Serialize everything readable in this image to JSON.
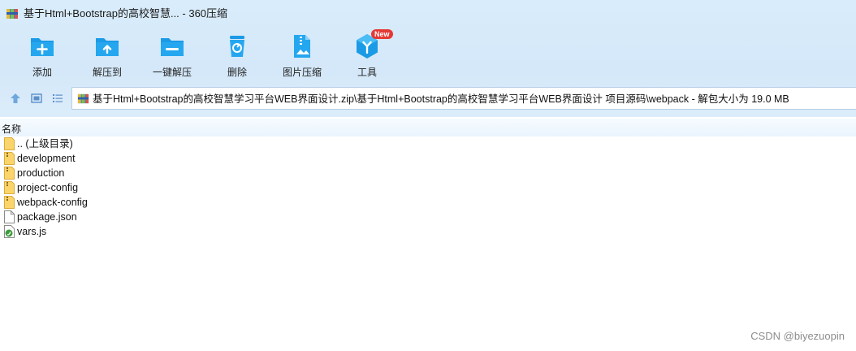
{
  "window": {
    "title": "基于Html+Bootstrap的高校智慧... - 360压缩"
  },
  "toolbar": {
    "items": [
      {
        "label": "添加",
        "icon": "add-folder-icon"
      },
      {
        "label": "解压到",
        "icon": "extract-to-icon"
      },
      {
        "label": "一键解压",
        "icon": "one-click-extract-icon"
      },
      {
        "label": "删除",
        "icon": "delete-icon"
      },
      {
        "label": "图片压缩",
        "icon": "image-compress-icon"
      },
      {
        "label": "工具",
        "icon": "tools-icon",
        "badge": "New"
      }
    ]
  },
  "address": {
    "path": "基于Html+Bootstrap的高校智慧学习平台WEB界面设计.zip\\基于Html+Bootstrap的高校智慧学习平台WEB界面设计 项目源码\\webpack - 解包大小为 19.0 MB"
  },
  "columns": {
    "name": "名称"
  },
  "files": [
    {
      "name": ".. (上级目录)",
      "type": "folder"
    },
    {
      "name": "development",
      "type": "folder-zip"
    },
    {
      "name": "production",
      "type": "folder-zip"
    },
    {
      "name": "project-config",
      "type": "folder-zip"
    },
    {
      "name": "webpack-config",
      "type": "folder-zip"
    },
    {
      "name": "package.json",
      "type": "file"
    },
    {
      "name": "vars.js",
      "type": "js"
    }
  ],
  "watermark": "CSDN @biyezuopin",
  "colors": {
    "accent": "#1a9be8",
    "toolbar_bg": "#d6e9fa",
    "badge": "#e53935"
  }
}
